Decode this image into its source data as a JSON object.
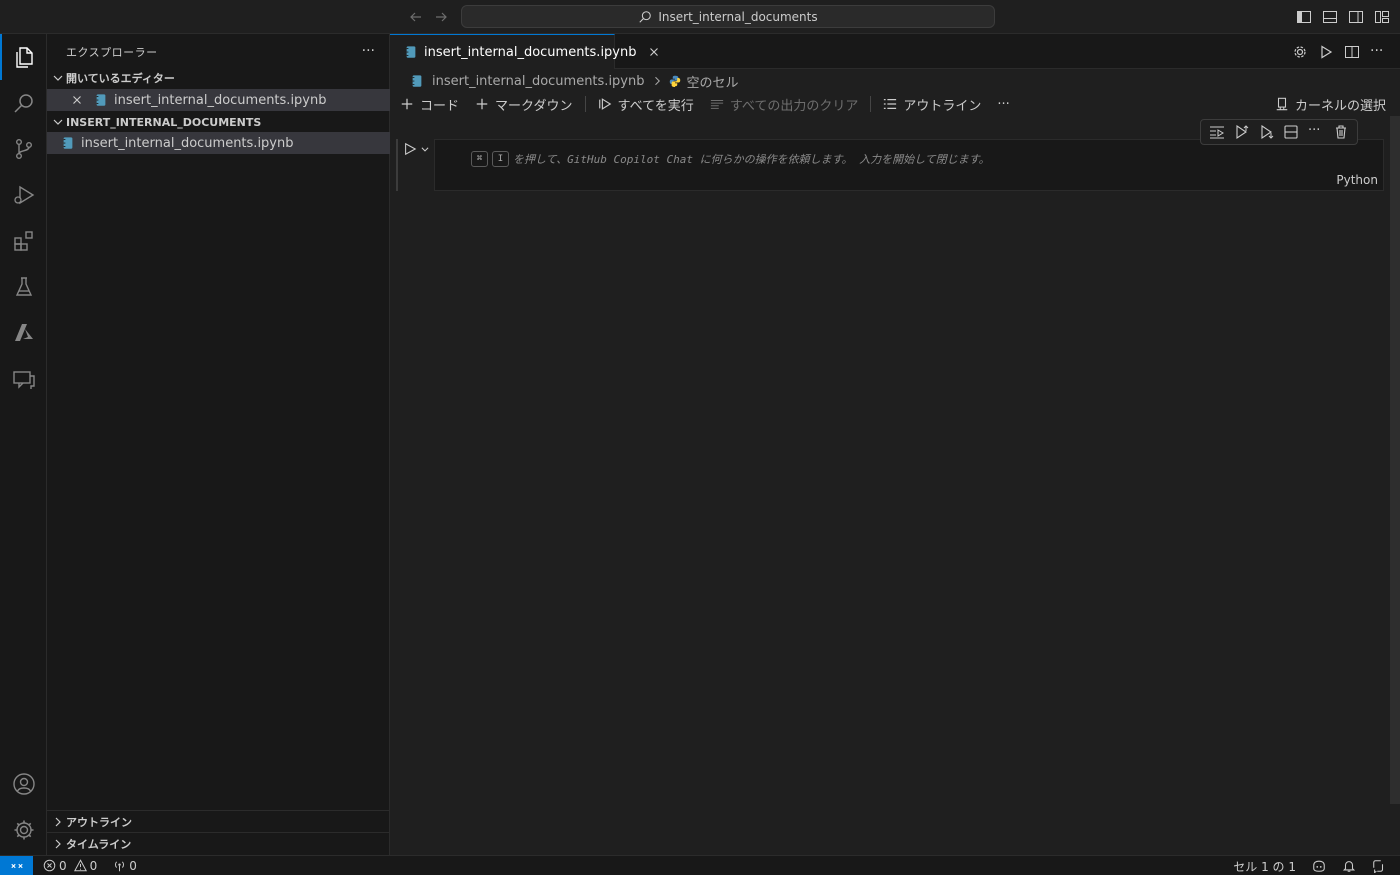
{
  "titlebar": {
    "search_text": "Insert_internal_documents"
  },
  "sidebar": {
    "title": "エクスプローラー",
    "open_editors": {
      "header": "開いているエディター",
      "items": [
        {
          "label": "insert_internal_documents.ipynb"
        }
      ]
    },
    "folder": {
      "header": "INSERT_INTERNAL_DOCUMENTS",
      "items": [
        {
          "label": "insert_internal_documents.ipynb"
        }
      ]
    },
    "outline_header": "アウトライン",
    "timeline_header": "タイムライン"
  },
  "editor": {
    "tab_label": "insert_internal_documents.ipynb",
    "breadcrumb": {
      "file": "insert_internal_documents.ipynb",
      "cell": "空のセル"
    },
    "toolbar": {
      "code": "コード",
      "markdown": "マークダウン",
      "run_all": "すべてを実行",
      "clear_outputs": "すべての出力のクリア",
      "outline": "アウトライン",
      "kernel": "カーネルの選択"
    },
    "cell": {
      "key1": "⌘",
      "key2": "I",
      "hint": "を押して、GitHub Copilot Chat に何らかの操作を依頼します。 入力を開始して閉じます。",
      "language": "Python"
    }
  },
  "statusbar": {
    "errors": "0",
    "warnings": "0",
    "ports": "0",
    "cell_position": "セル 1 の 1"
  },
  "colors": {
    "accent": "#0078d4",
    "background": "#1f1f1f",
    "sidebar_bg": "#181818",
    "selection": "#37373d",
    "notebook_icon": "#519aba"
  }
}
